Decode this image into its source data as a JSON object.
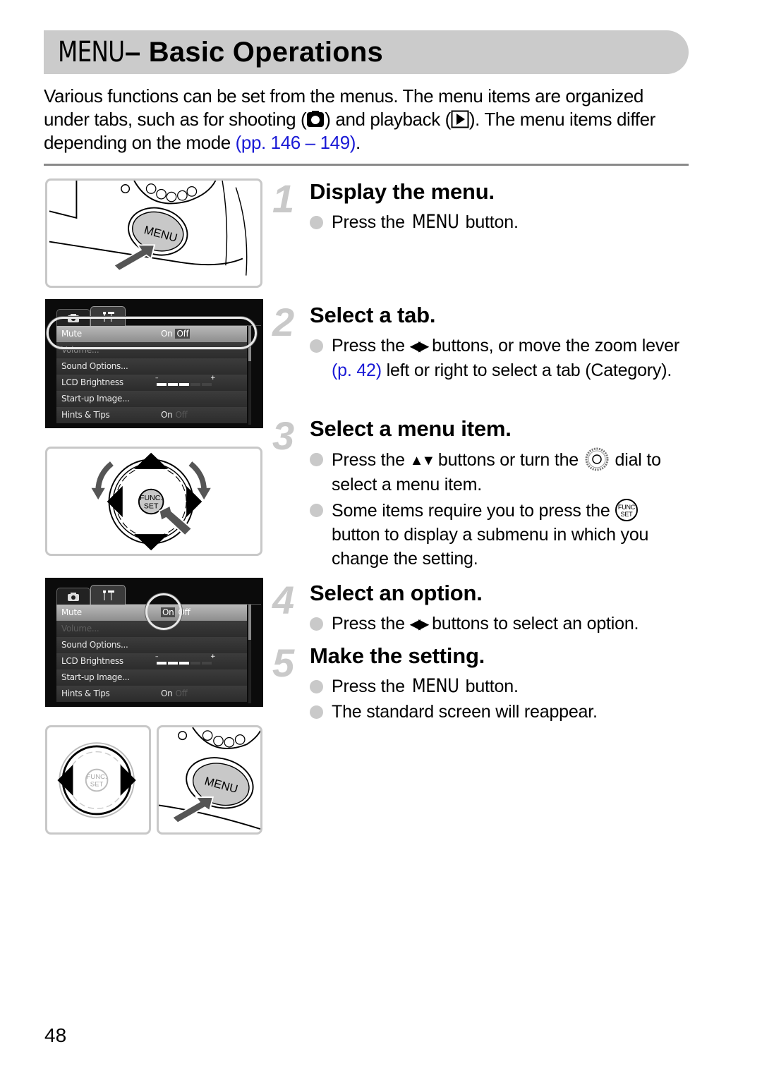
{
  "header": {
    "title_menu_word": "MENU",
    "title_rest": "– Basic Operations"
  },
  "intro": {
    "part1": "Various functions can be set from the menus. The menu items are organized under tabs, such as for shooting (",
    "shooting_icon": "camera-icon",
    "part2": ") and playback (",
    "playback_icon": "playback-icon",
    "part3": "). The menu items differ depending on the mode ",
    "link": "(pp. 146 – 149)",
    "part4": "."
  },
  "steps": [
    {
      "number": "1",
      "title": "Display the menu.",
      "bullets": [
        {
          "pre": "Press the ",
          "menu_word": "MENU",
          "post": " button."
        }
      ]
    },
    {
      "number": "2",
      "title": "Select a tab.",
      "bullets": [
        {
          "pre": "Press the ",
          "arrows": "◀▶",
          "mid": " buttons, or move the zoom lever ",
          "link": "(p. 42)",
          "post": " left or right to select a tab (Category)."
        }
      ]
    },
    {
      "number": "3",
      "title": "Select a menu item.",
      "bullets": [
        {
          "pre": "Press the ",
          "arrows": "▲▼",
          "mid": " buttons or turn the ",
          "icon": "control-dial-icon",
          "post": " dial to select a menu item."
        },
        {
          "pre": "Some items require you to press the ",
          "icon": "func-set-button-icon",
          "post": " button to display a submenu in which you change the setting."
        }
      ]
    },
    {
      "number": "4",
      "title": "Select an option.",
      "bullets": [
        {
          "pre": "Press the ",
          "arrows": "◀▶",
          "post": " buttons to select an option."
        }
      ]
    },
    {
      "number": "5",
      "title": "Make the setting.",
      "bullets": [
        {
          "pre": "Press the ",
          "menu_word": "MENU",
          "post": " button."
        },
        {
          "text": "The standard screen will reappear."
        }
      ]
    }
  ],
  "figures": {
    "menu_button_label": "MENU",
    "func_set_label_1": "FUNC.",
    "func_set_label_2": "SET"
  },
  "lcd_screen": {
    "tabs": [
      "camera-tab",
      "setup-tab"
    ],
    "rows": [
      {
        "label": "Mute",
        "on": "On",
        "off": "Off"
      },
      {
        "label": "Volume..."
      },
      {
        "label": "Sound Options..."
      },
      {
        "label": "LCD Brightness",
        "minus": "–",
        "plus": "+",
        "level": 3,
        "max_level": 5
      },
      {
        "label": "Start-up Image..."
      },
      {
        "label": "Hints & Tips",
        "on": "On",
        "off": "Off"
      }
    ]
  },
  "page_number": "48"
}
